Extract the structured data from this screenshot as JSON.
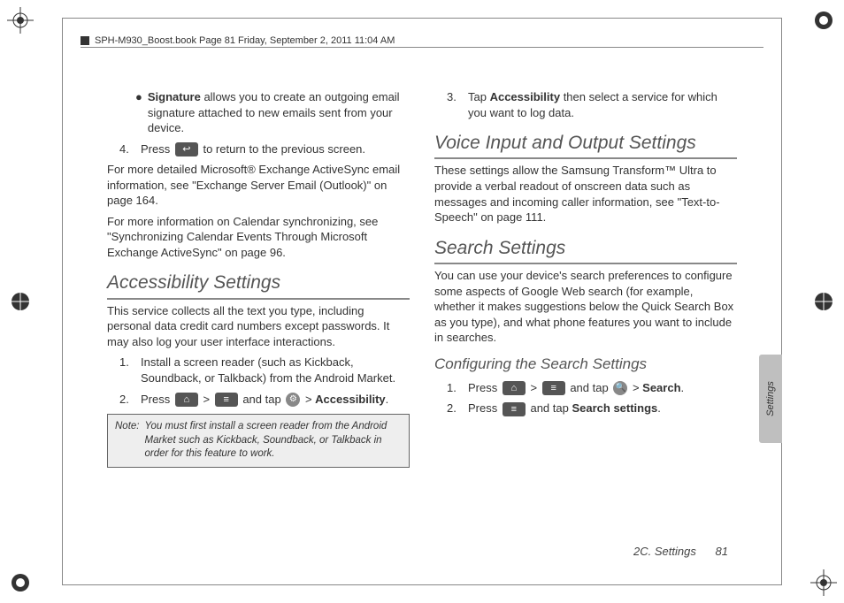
{
  "header": {
    "text": "SPH-M930_Boost.book  Page 81  Friday, September 2, 2011  11:04 AM"
  },
  "left": {
    "bullet1_bold": "Signature",
    "bullet1_rest": " allows you to create an outgoing email signature attached to new emails sent from your device.",
    "step4_num": "4.",
    "step4_a": "Press ",
    "step4_b": " to return to the previous screen.",
    "para1": "For more detailed Microsoft® Exchange ActiveSync email information, see \"Exchange Server Email (Outlook)\" on page 164.",
    "para2": "For more information on Calendar synchronizing, see \"Synchronizing Calendar Events Through Microsoft Exchange ActiveSync\" on page 96.",
    "h2": "Accessibility Settings",
    "para3": "This service collects all the text you type, including personal data credit card numbers except passwords. It may also log your user interface interactions.",
    "acc1_num": "1.",
    "acc1": "Install a screen reader (such as Kickback, Soundback, or Talkback) from the Android Market.",
    "acc2_num": "2.",
    "acc2_a": "Press ",
    "acc2_gt1": " > ",
    "acc2_b": " and tap ",
    "acc2_gt2": " > ",
    "acc2_bold": "Accessibility",
    "acc2_dot": ".",
    "note_label": "Note:",
    "note_body": "You must first install a screen reader from the Android Market such as Kickback, Soundback, or Talkback in order for this feature to work."
  },
  "right": {
    "step3_num": "3.",
    "step3_a": "Tap ",
    "step3_bold": "Accessibility",
    "step3_b": " then select a service for which you want to log data.",
    "h2a": "Voice Input and Output Settings",
    "para_a": "These settings allow the Samsung Transform™ Ultra  to provide a verbal readout of onscreen data such as messages and incoming caller information, see \"Text-to-Speech\" on page 111.",
    "h2b": "Search Settings",
    "para_b": "You can use your device's search preferences to configure some aspects of Google Web search (for example, whether it makes suggestions below the Quick Search Box as you type), and what phone features you want to include in searches.",
    "h3": "Configuring the Search Settings",
    "s1_num": "1.",
    "s1_a": "Press ",
    "s1_gt1": " > ",
    "s1_b": " and tap ",
    "s1_gt2": " > ",
    "s1_bold": "Search",
    "s1_dot": ".",
    "s2_num": "2.",
    "s2_a": "Press ",
    "s2_b": " and tap ",
    "s2_bold": "Search settings",
    "s2_dot": "."
  },
  "footer": {
    "section": "2C. Settings",
    "page": "81"
  },
  "sidetab": "Settings",
  "icons": {
    "back": "↩",
    "home": "⌂",
    "menu": "≡",
    "settings": "⚙",
    "search": "🔍"
  }
}
